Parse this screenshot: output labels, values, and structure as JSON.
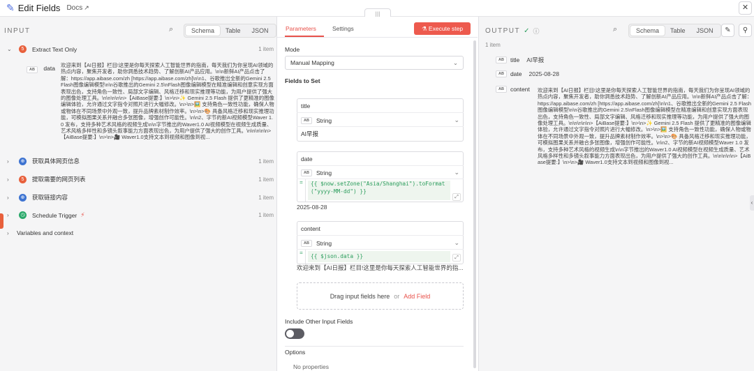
{
  "header": {
    "title": "Edit Fields",
    "docs_label": "Docs"
  },
  "input": {
    "title": "INPUT",
    "tabs": [
      "Schema",
      "Table",
      "JSON"
    ],
    "nodes": [
      {
        "name": "Extract Text Only",
        "count": "1 item",
        "icon": "html-icon",
        "expanded": true
      },
      {
        "name": "获取具体网页信息",
        "count": "1 item",
        "icon": "globe-icon"
      },
      {
        "name": "提取需要的网页列表",
        "count": "1 item",
        "icon": "html-icon"
      },
      {
        "name": "获取链接内容",
        "count": "1 item",
        "icon": "globe-icon"
      },
      {
        "name": "Schedule Trigger",
        "count": "1 item",
        "icon": "clock-icon"
      }
    ],
    "field": {
      "type": "AB",
      "name": "data"
    },
    "data_text": "欢迎来到【AI日报】栏目!这里是你每天探索人工智能世界的指南，每天我们为你呈现AI领域的热点内容，聚焦开发者，助你洞悉技术趋势、了解创新AI产品应用。\\n\\n新鲜AI产品点击了解：https://app.aibase.com/zh [https://app.aibase.com/zh]\\n\\n1、谷歌推出全新的Gemini 2.5 Flash图像编辑模型\\n\\n谷歌推出的Gemini 2.5\\nFlash图像编辑模型在精准编辑和创意实现方面表现出色，支持角色一致性、局部文字编辑、风格迁移和现实推理等功能，为用户提供了强大的图像处理工具。\\n\\n\\n\\n\\n>【AiBase提要:】\\n>\\n>✨ Gemini 2.5 Flash 提供了更精准的图像编辑体验，允许通过文字指令对照片进行大幅修改。\\n>\\n>🖼️ 支持角色一致性功能，确保人物或物体在不同场景中外观一致，提升品牌素材制作效率。\\n>\\n>🎨 具备风格迁移和现实推理功能，可模拟图果关系并融合多张图像，增强创作可能性。\\n\\n2、字节的新AI视频模型Waver 1.0 发布，支持多种艺术风格的视频生成\\n\\n字节推出的Waver1.0 AI视频模型在视频生成质量、艺术风格多样性和多镜头叙事能力方面表现出色，为用户提供了强大的创作工具。\\n\\n\\n\\n\\n>【AiBase提要:】\\n>\\n>🎥 Waver1.0支持文本到视频和图像到视...",
    "variables_label": "Variables and context"
  },
  "params": {
    "tabs": [
      "Parameters",
      "Settings"
    ],
    "execute_label": "Execute step",
    "mode_label": "Mode",
    "mode_value": "Manual Mapping",
    "fields_label": "Fields to Set",
    "fields": [
      {
        "name": "title",
        "type": "String",
        "value": "AI早报"
      },
      {
        "name": "date",
        "type": "String",
        "expr_line1": "{{ $now.setZone(\"Asia/Shanghai\").toFormat",
        "expr_line2": "(\"yyyy-MM-dd\") }}",
        "result": "2025-08-28"
      },
      {
        "name": "content",
        "type": "String",
        "expr_line1": "{{ $json.data }}",
        "result": "欢迎来到【AI日报】栏目!这里是你每天探索人工智能世界的指..."
      }
    ],
    "drop_text": "Drag input fields here",
    "drop_or": "or",
    "add_field": "Add Field",
    "include_label": "Include Other Input Fields",
    "options_label": "Options",
    "no_props": "No properties"
  },
  "output": {
    "title": "OUTPUT",
    "tabs": [
      "Schema",
      "Table",
      "JSON"
    ],
    "count": "1 item",
    "fields": [
      {
        "type": "AB",
        "name": "title",
        "value": "AI早报"
      },
      {
        "type": "AB",
        "name": "date",
        "value": "2025-08-28"
      },
      {
        "type": "AB",
        "name": "content"
      }
    ],
    "content_text": "欢迎来到【AI日报】栏目!这里是你每天探索人工智能世界的指南，每天我们为你呈现AI领域的热点内容，聚焦开发者，助你洞悉技术趋势、了解创新AI产品应用。\\n\\n新鲜AI产品点击了解：https://app.aibase.com/zh [https://app.aibase.com/zh]\\n\\n1、谷歌推出全新的Gemini 2.5 Flash图像编辑模型\\n\\n谷歌推出的Gemini 2.5\\nFlash图像编辑模型在精准编辑和创意实现方面表现出色，支持角色一致性、局部文字编辑、风格迁移和现实推理等功能，为用户提供了强大的图像处理工具。\\n\\n\\n\\n\\n>【AiBase提要:】\\n>\\n>✨ Gemini 2.5 Flash 提供了更精准的图像编辑体验，允许通过文字指令对照片进行大幅修改。\\n>\\n>🖼️ 支持角色一致性功能，确保人物或物体在不同场景中外观一致，提升品牌素材制作效率。\\n>\\n>🎨 具备风格迁移和现实推理功能，可模拟图果关系并融合多张图像，增强创作可能性。\\n\\n2、字节的新AI视频模型Waver 1.0 发布，支持多种艺术风格的视频生成\\n\\n字节推出的Waver1.0 AI视频模型在视频生成质量、艺术风格多样性和多镜头叙事能力方面表现出色，为用户提供了强大的创作工具。\\n\\n\\n\\n\\n>【AiBase提要:】\\n>\\n>🎥 Waver1.0支持文本到视频和图像到视..."
  },
  "colors": {
    "accent": "#ed5a4e",
    "success": "#2a9d5c"
  }
}
